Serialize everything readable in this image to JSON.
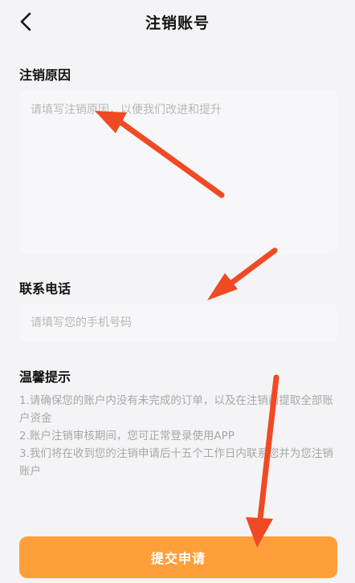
{
  "header": {
    "back_icon": "chevron-left-icon",
    "title": "注销账号"
  },
  "reason": {
    "label": "注销原因",
    "placeholder": "请填写注销原因，以便我们改进和提升"
  },
  "phone": {
    "label": "联系电话",
    "placeholder": "请填写您的手机号码"
  },
  "tips": {
    "label": "温馨提示",
    "items": [
      "1.请确保您的账户内没有未完成的订单，以及在注销前提取全部账户资金",
      "2.账户注销审核期间，您可正常登录使用APP",
      "3.我们将在收到您的注销申请后十五个工作日内联系您并为您注销账户"
    ]
  },
  "submit": {
    "label": "提交申请",
    "color": "#ff9f3c"
  },
  "annotation": {
    "arrow_color": "#f04a25",
    "arrow_icon": "red-arrow-icon"
  }
}
